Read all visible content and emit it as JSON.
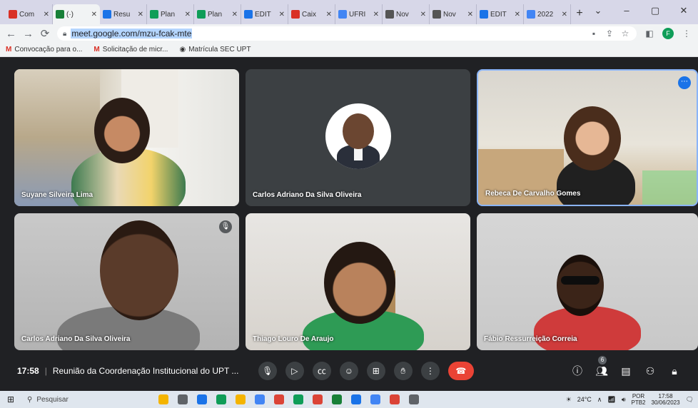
{
  "browser": {
    "tabs": [
      {
        "label": "Com",
        "color": "#d93025"
      },
      {
        "label": "(·)",
        "color": "#188038",
        "active": true
      },
      {
        "label": "Resu",
        "color": "#1a73e8"
      },
      {
        "label": "Plan",
        "color": "#0f9d58"
      },
      {
        "label": "Plan",
        "color": "#0f9d58"
      },
      {
        "label": "EDIT",
        "color": "#1a73e8"
      },
      {
        "label": "Caix",
        "color": "#d93025"
      },
      {
        "label": "UFRI",
        "color": "#4285f4"
      },
      {
        "label": "Nov",
        "color": "#555555"
      },
      {
        "label": "Nov",
        "color": "#555555"
      },
      {
        "label": "EDIT",
        "color": "#1a73e8"
      },
      {
        "label": "2022",
        "color": "#4285f4"
      }
    ],
    "new_tab": "+",
    "window_controls": [
      "⌄",
      "–",
      "▢",
      "✕"
    ],
    "url": "meet.google.com/mzu-fcak-mte",
    "profile_initial": "F",
    "bookmarks": [
      {
        "label": "Convocação para o..."
      },
      {
        "label": "Solicitação de micr..."
      },
      {
        "label": "Matrícula SEC UPT"
      }
    ]
  },
  "participants": [
    {
      "name": "Suyane Silveira Lima"
    },
    {
      "name": "Carlos Adriano Da Silva Oliveira"
    },
    {
      "name": "Rebeca De Carvalho Gomes"
    },
    {
      "name": "Carlos Adriano Da Silva Oliveira"
    },
    {
      "name": "Thiago Louro De Araujo"
    },
    {
      "name": "Fábio Ressurreição Correia"
    }
  ],
  "meet": {
    "time": "17:58",
    "separator": "|",
    "meeting_title": "Reunião da Coordenação Institucional do UPT ...",
    "participant_count": "6",
    "accent": "#1a73e8",
    "hangup_color": "#ea4335"
  },
  "taskbar": {
    "search_placeholder": "Pesquisar",
    "weather": "24°C",
    "language": "POR",
    "language_sub": "PTB2",
    "clock_time": "17:58",
    "clock_date": "30/06/2023",
    "app_colors": [
      "#f4b400",
      "#5f6368",
      "#1a73e8",
      "#0f9d58",
      "#f4b400",
      "#4285f4",
      "#db4437",
      "#0f9d58",
      "#db4437",
      "#188038",
      "#1a73e8",
      "#4285f4",
      "#db4437",
      "#5f6368"
    ]
  }
}
